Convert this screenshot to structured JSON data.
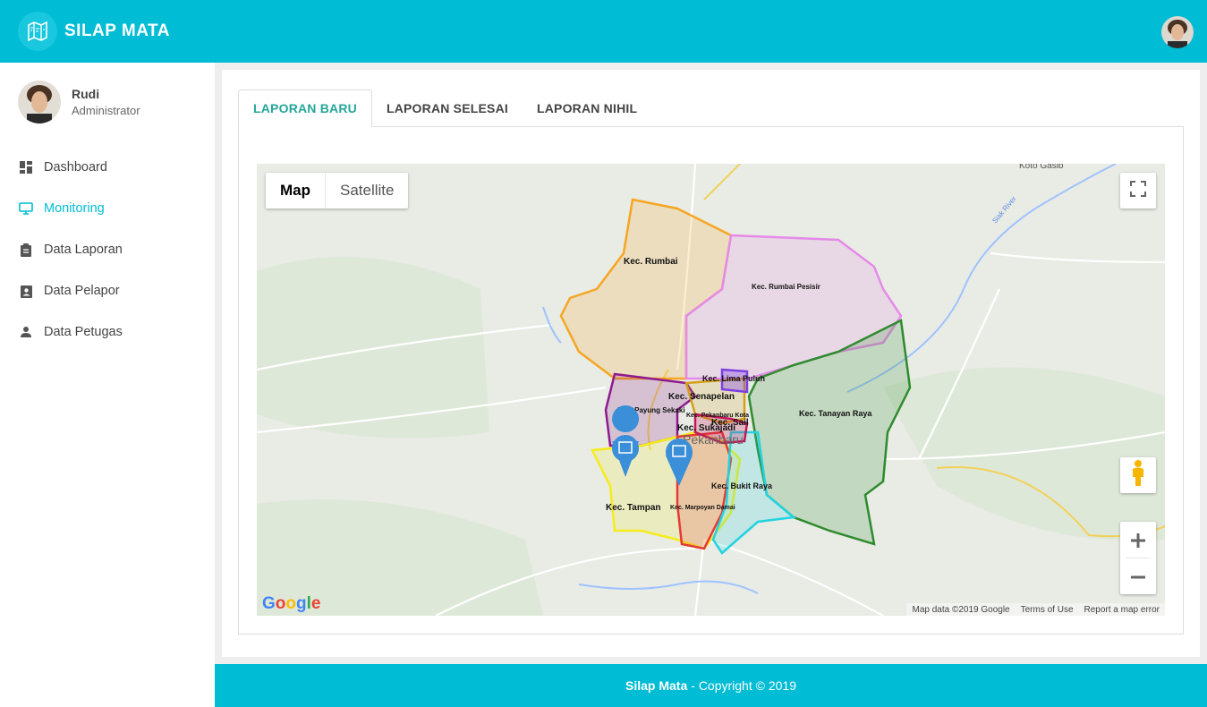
{
  "app": {
    "title": "SILAP MATA"
  },
  "user": {
    "name": "Rudi",
    "role": "Administrator"
  },
  "sidebar": {
    "items": [
      {
        "label": "Dashboard",
        "icon": "dashboard-icon",
        "active": false
      },
      {
        "label": "Monitoring",
        "icon": "monitor-icon",
        "active": true
      },
      {
        "label": "Data Laporan",
        "icon": "clipboard-icon",
        "active": false
      },
      {
        "label": "Data Pelapor",
        "icon": "contact-badge-icon",
        "active": false
      },
      {
        "label": "Data Petugas",
        "icon": "person-icon",
        "active": false
      }
    ]
  },
  "tabs": [
    {
      "label": "LAPORAN BARU",
      "active": true
    },
    {
      "label": "LAPORAN SELESAI",
      "active": false
    },
    {
      "label": "LAPORAN NIHIL",
      "active": false
    }
  ],
  "map": {
    "type_buttons": [
      "Map",
      "Satellite"
    ],
    "selected_type": "Map",
    "city_label": "Pekanbaru",
    "place_label": "Koto Gasib",
    "river_label": "Siak River",
    "districts": [
      {
        "name": "Kec. Rumbai",
        "color": "#f5a623"
      },
      {
        "name": "Kec. Rumbai Pesisir",
        "color": "#e58ae8"
      },
      {
        "name": "Kec. Lima Puluh",
        "color": "#7b3fe4"
      },
      {
        "name": "Kec. Senapelan",
        "color": "#d4a017"
      },
      {
        "name": "Kec. Payung Sekaki",
        "color": "#8e1a8e"
      },
      {
        "name": "Kec. Pekanbaru Kota",
        "color": "#444444"
      },
      {
        "name": "Kec. Sail",
        "color": "#2a2a2a"
      },
      {
        "name": "Kec. Sukajadi",
        "color": "#c2185b"
      },
      {
        "name": "Kec. Tanayan Raya",
        "color": "#2e8b2e"
      },
      {
        "name": "Kec. Bukit Raya",
        "color": "#22d3e0"
      },
      {
        "name": "Kec. Tampan",
        "color": "#f5ec1a"
      },
      {
        "name": "Kec. Marpoyan Damai",
        "color": "#e53935"
      }
    ],
    "markers": [
      "report-marker-icon",
      "report-marker-icon"
    ],
    "attribution": [
      "Map data ©2019 Google",
      "Terms of Use",
      "Report a map error"
    ],
    "logo": "Google"
  },
  "footer": {
    "brand": "Silap Mata",
    "text": "- Copyright © 2019"
  },
  "colors": {
    "primary": "#00bcd4",
    "active_tab": "#26a69a"
  }
}
